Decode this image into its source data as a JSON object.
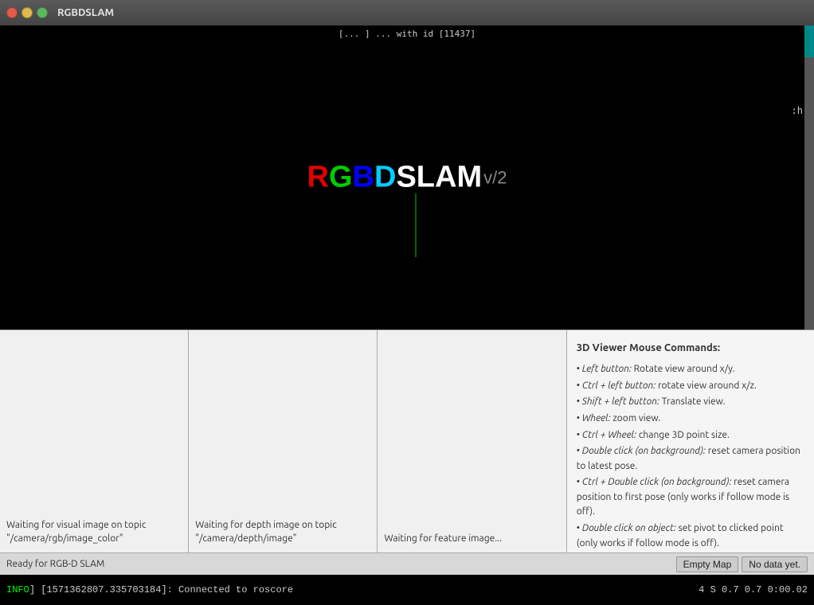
{
  "titlebar": {
    "title": "RGBDSLAM"
  },
  "logo": {
    "r": "R",
    "g": "G",
    "b": "B",
    "d": "D",
    "slam": "SLAM",
    "v2": "v/2"
  },
  "top_text": "[... ] ... with id [11437]",
  "right_labels": {
    "h": ":h",
    "scroll": ""
  },
  "panels": {
    "visual": {
      "text": "Waiting for visual image on topic \"/camera/rgb/image_color\""
    },
    "depth": {
      "text": "Waiting for depth image on topic \"/camera/depth/image\""
    },
    "feature": {
      "text": "Waiting for feature image..."
    },
    "info": {
      "title": "3D Viewer Mouse Commands:",
      "lines": [
        "• Left button: Rotate view around x/y.",
        "• Ctrl + left button: rotate view around x/z.",
        "• Shift + left button: Translate view.",
        "• Wheel: zoom view.",
        "• Ctrl + Wheel: change 3D point size.",
        "• Double click (on background): reset camera position to latest pose.",
        "• Ctrl + Double click (on background): reset camera position to first pose (only works if follow mode is off).",
        "• Double click on object: set pivot to clicked point (only works if follow mode is off)."
      ]
    }
  },
  "status_bar": {
    "ready_text": "Ready for RGB-D SLAM",
    "empty_map_btn": "Empty Map",
    "no_data_btn": "No data yet."
  },
  "terminal": {
    "line1": "INFO] [1571362807.335703184]: Connected to roscore",
    "stats": "4 S  0.7  0.7  0:00.02"
  }
}
